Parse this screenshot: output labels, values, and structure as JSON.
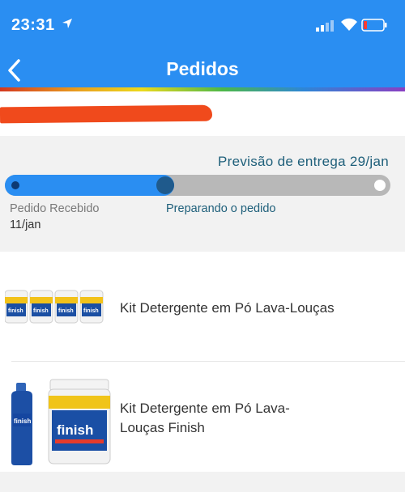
{
  "status_bar": {
    "time": "23:31"
  },
  "nav": {
    "title": "Pedidos"
  },
  "delivery": {
    "forecast": "Previsão de entrega 29/jan",
    "progress": 0.44,
    "steps": [
      {
        "label": "Pedido Recebido",
        "date": "11/jan"
      },
      {
        "label": "Preparando o pedido"
      }
    ]
  },
  "items": [
    {
      "name": "Kit Detergente em Pó Lava-Louças",
      "image": "four-finish-powder-tubs"
    },
    {
      "name": "Kit Detergente em Pó Lava-Louças Finish",
      "image": "finish-rinse-bottle-and-powder-tub"
    }
  ],
  "colors": {
    "header": "#2a8ef2",
    "progress_fill": "#2a8ef2",
    "progress_track": "#b8b8b8",
    "accent_text": "#1e5f7a",
    "redaction": "#f04a1c"
  }
}
